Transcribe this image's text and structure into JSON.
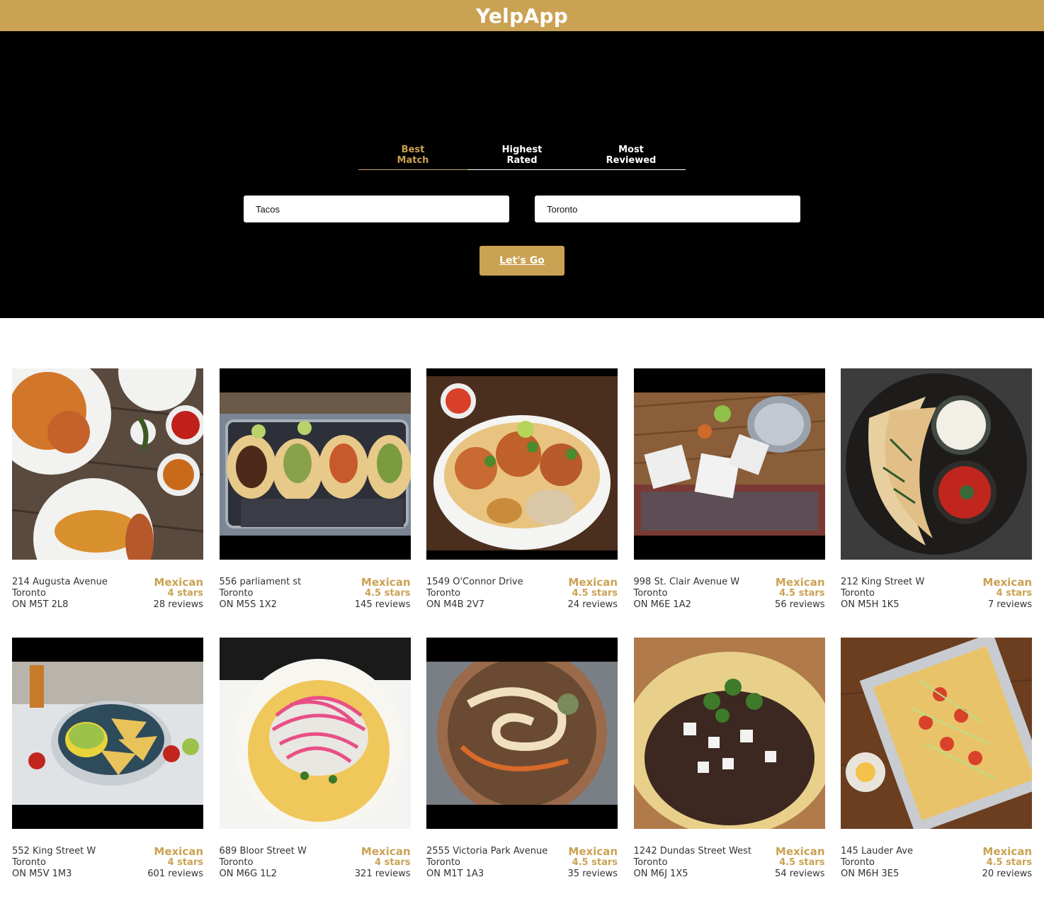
{
  "header": {
    "title": "YelpApp"
  },
  "sort_tabs": [
    {
      "label": "Best\nMatch",
      "active": true
    },
    {
      "label": "Highest\nRated",
      "active": false
    },
    {
      "label": "Most\nReviewed",
      "active": false
    }
  ],
  "search": {
    "term_value": "Tacos",
    "location_value": "Toronto",
    "submit_label": "Let's Go"
  },
  "colors": {
    "accent": "#caa253",
    "hero_bg": "#000000"
  },
  "businesses": [
    {
      "address": "214 Augusta Avenue",
      "city": "Toronto",
      "province_zip": "ON M5T 2L8",
      "category": "Mexican",
      "rating": "4 stars",
      "reviews": "28 reviews",
      "photo": "tacos-on-plates-overhead"
    },
    {
      "address": "556 parliament st",
      "city": "Toronto",
      "province_zip": "ON M5S 1X2",
      "category": "Mexican",
      "rating": "4.5 stars",
      "reviews": "145 reviews",
      "photo": "tacos-on-metal-tray"
    },
    {
      "address": "1549 O'Connor Drive",
      "city": "Toronto",
      "province_zip": "ON M4B 2V7",
      "category": "Mexican",
      "rating": "4.5 stars",
      "reviews": "24 reviews",
      "photo": "tacos-on-white-plate"
    },
    {
      "address": "998 St. Clair Avenue W",
      "city": "Toronto",
      "province_zip": "ON M6E 1A2",
      "category": "Mexican",
      "rating": "4.5 stars",
      "reviews": "56 reviews",
      "photo": "takeout-bags-on-rug"
    },
    {
      "address": "212 King Street W",
      "city": "Toronto",
      "province_zip": "ON M5H 1K5",
      "category": "Mexican",
      "rating": "4 stars",
      "reviews": "7 reviews",
      "photo": "quesadilla-with-dips"
    },
    {
      "address": "552 King Street W",
      "city": "Toronto",
      "province_zip": "ON M5V 1M3",
      "category": "Mexican",
      "rating": "4 stars",
      "reviews": "601 reviews",
      "photo": "chips-and-guacamole"
    },
    {
      "address": "689 Bloor Street W",
      "city": "Toronto",
      "province_zip": "ON M6G 1L2",
      "category": "Mexican",
      "rating": "4 stars",
      "reviews": "321 reviews",
      "photo": "taco-with-pickled-onion"
    },
    {
      "address": "2555 Victoria Park Avenue",
      "city": "Toronto",
      "province_zip": "ON M1T 1A3",
      "category": "Mexican",
      "rating": "4.5 stars",
      "reviews": "35 reviews",
      "photo": "bowl-with-sauce-swirl"
    },
    {
      "address": "1242 Dundas Street West",
      "city": "Toronto",
      "province_zip": "ON M6J 1X5",
      "category": "Mexican",
      "rating": "4.5 stars",
      "reviews": "54 reviews",
      "photo": "beef-taco-with-onion"
    },
    {
      "address": "145 Lauder Ave",
      "city": "Toronto",
      "province_zip": "ON M6H 3E5",
      "category": "Mexican",
      "rating": "4.5 stars",
      "reviews": "20 reviews",
      "photo": "loaded-nachos-tray"
    }
  ]
}
